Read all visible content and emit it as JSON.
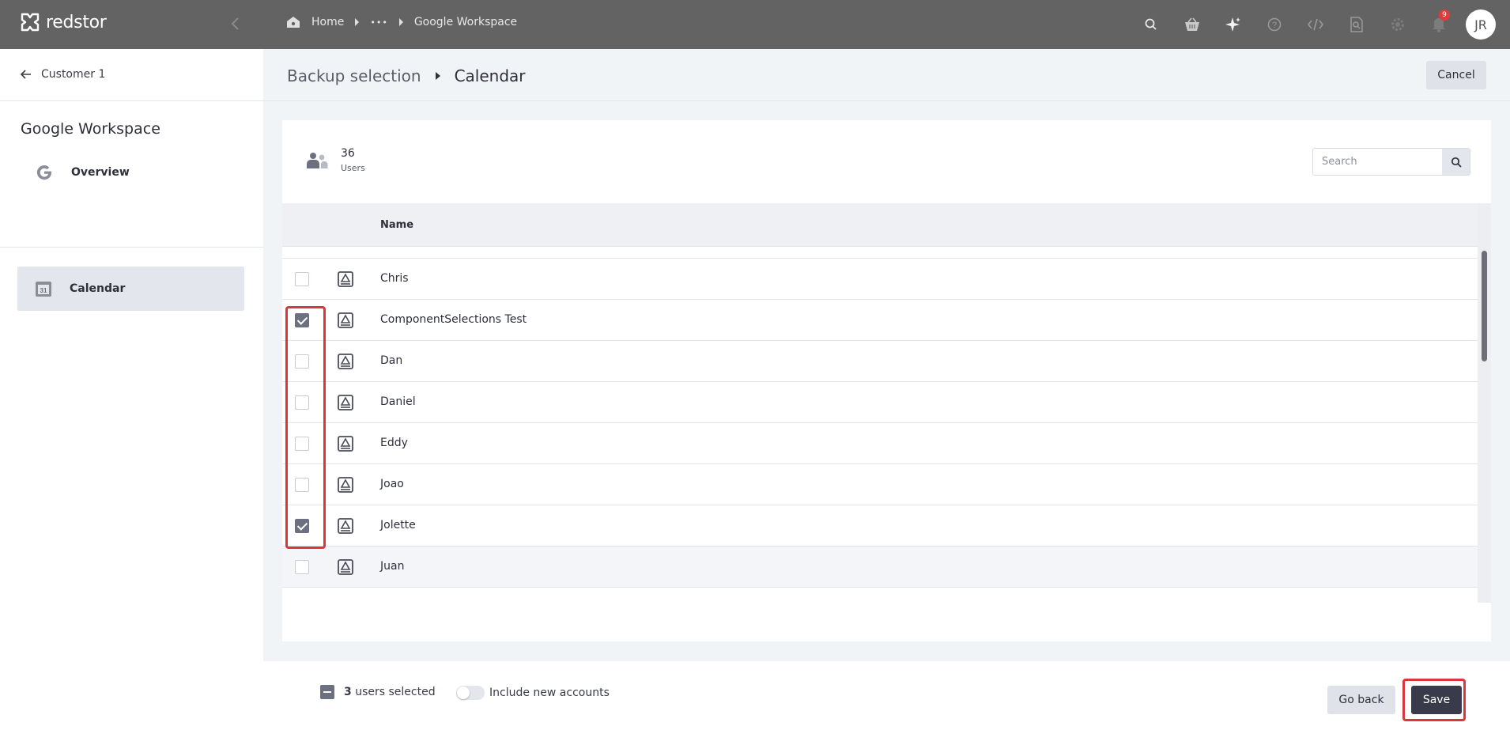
{
  "app": {
    "logo_text": "redstor"
  },
  "breadcrumb": {
    "home": "Home",
    "ellipsis": "•••",
    "current": "Google Workspace"
  },
  "topbar": {
    "icons": [
      "search-icon",
      "basket-icon",
      "sparkle-icon",
      "help-icon",
      "code-icon",
      "inspect-icon",
      "settings-icon",
      "bell-icon"
    ],
    "notification_count": "9",
    "avatar_initials": "JR"
  },
  "sidebar": {
    "back_label": "Customer 1",
    "title": "Google Workspace",
    "items": [
      {
        "label": "Overview",
        "icon": "google-icon",
        "active": false
      },
      {
        "label": "Calendar",
        "icon": "calendar-icon",
        "active": true
      }
    ]
  },
  "header": {
    "parent": "Backup selection",
    "current": "Calendar",
    "cancel_label": "Cancel"
  },
  "summary": {
    "count": "36",
    "label": "Users"
  },
  "search": {
    "placeholder": "Search",
    "value": ""
  },
  "table": {
    "column_name": "Name",
    "rows": [
      {
        "name": "Chris",
        "checked": false
      },
      {
        "name": "ComponentSelections Test",
        "checked": true
      },
      {
        "name": "Dan",
        "checked": false
      },
      {
        "name": "Daniel",
        "checked": false
      },
      {
        "name": "Eddy",
        "checked": false
      },
      {
        "name": "Joao",
        "checked": false
      },
      {
        "name": "Jolette",
        "checked": true
      },
      {
        "name": "Juan",
        "checked": false
      }
    ]
  },
  "footer": {
    "selected_count": "3",
    "selected_label": "users selected",
    "include_new_label": "Include new accounts",
    "include_new_enabled": false,
    "goback_label": "Go back",
    "save_label": "Save"
  },
  "colors": {
    "topbar": "#636363",
    "accent_dark": "#3a3b4a",
    "highlight": "#d9363e",
    "checkbox_checked": "#6d7080"
  }
}
